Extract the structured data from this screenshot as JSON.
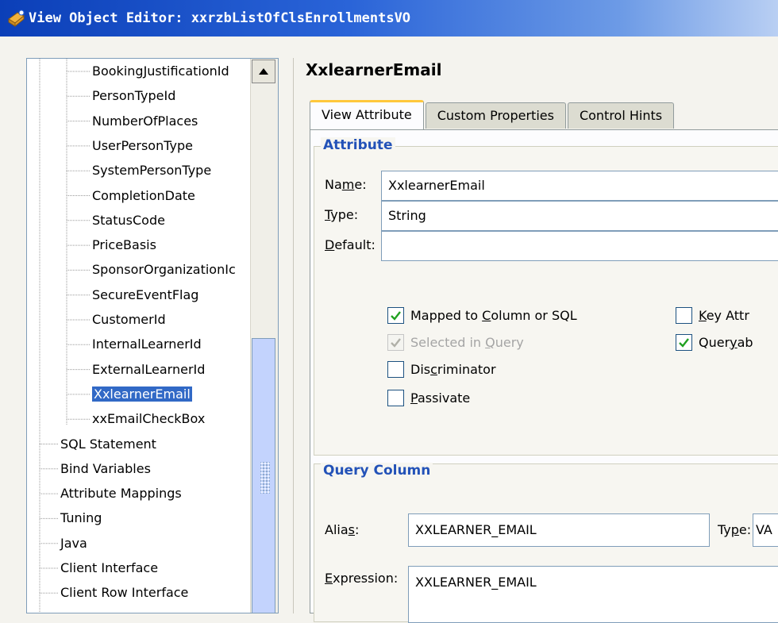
{
  "window": {
    "title": "View Object Editor: xxrzbListOfClsEnrollmentsVO"
  },
  "tree": {
    "children": [
      "BookingJustificationId",
      "PersonTypeId",
      "NumberOfPlaces",
      "UserPersonType",
      "SystemPersonType",
      "CompletionDate",
      "StatusCode",
      "PriceBasis",
      "SponsorOrganizationIc",
      "SecureEventFlag",
      "CustomerId",
      "InternalLearnerId",
      "ExternalLearnerId",
      "XxlearnerEmail",
      "xxEmailCheckBox"
    ],
    "top_level": [
      "SQL Statement",
      "Bind Variables",
      "Attribute Mappings",
      "Tuning",
      "Java",
      "Client Interface",
      "Client Row Interface"
    ],
    "selected": "XxlearnerEmail"
  },
  "editor": {
    "header": "XxlearnerEmail",
    "tabs": [
      "View Attribute",
      "Custom Properties",
      "Control Hints"
    ],
    "active_tab": "View Attribute",
    "attribute": {
      "group_title": "Attribute",
      "name_label_pre": "Na",
      "name_label_u": "m",
      "name_label_post": "e:",
      "name_value": "XxlearnerEmail",
      "type_label_u": "T",
      "type_label_post": "ype:",
      "type_value": "String",
      "default_label_u": "D",
      "default_label_post": "efault:",
      "default_value": "",
      "checkboxes": {
        "mapped": {
          "pre": "Mapped to ",
          "u": "C",
          "post": "olumn or SQL",
          "checked": true
        },
        "selected": {
          "pre": "Selected in ",
          "u": "Q",
          "post": "uery",
          "checked": true,
          "disabled": true
        },
        "discriminator": {
          "pre": "Dis",
          "u": "c",
          "post": "riminator",
          "checked": false
        },
        "passivate": {
          "pre": "",
          "u": "P",
          "post": "assivate",
          "checked": false
        },
        "key": {
          "pre": "",
          "u": "K",
          "post": "ey Attr",
          "checked": false
        },
        "queryable": {
          "pre": "Quer",
          "u": "y",
          "post": "ab",
          "checked": true
        }
      }
    },
    "query_column": {
      "group_title": "Query Column",
      "alias_label_pre": "Alia",
      "alias_label_u": "s",
      "alias_label_post": ":",
      "alias_value": "XXLEARNER_EMAIL",
      "type_label_pre": "Ty",
      "type_label_u": "p",
      "type_label_post": "e:",
      "type_value": "VA",
      "expression_label_u": "E",
      "expression_label_post": "xpression:",
      "expression_value": "XXLEARNER_EMAIL"
    }
  },
  "colors": {
    "titlebar": "#0b3fb8",
    "selection": "#3169c6",
    "group_title": "#2352b8",
    "active_tab_accent": "#ffc83c"
  }
}
